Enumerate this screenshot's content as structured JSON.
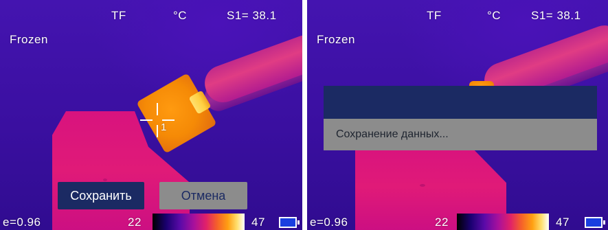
{
  "left_screen": {
    "storage": "TF",
    "unit": "°C",
    "spot_reading": "S1= 38.1",
    "mode": "Frozen",
    "spot_marker": "1",
    "emissivity": "e=0.96",
    "scale_min": "22",
    "scale_max": "47",
    "buttons": {
      "save": "Сохранить",
      "cancel": "Отмена"
    }
  },
  "right_screen": {
    "storage": "TF",
    "unit": "°C",
    "spot_reading": "S1= 38.1",
    "mode": "Frozen",
    "emissivity": "e=0.96",
    "scale_min": "22",
    "scale_max": "47",
    "dialog_message": "Сохранение данных..."
  },
  "colors": {
    "button_dark": "#1b2a63",
    "button_gray": "#8c8c8c",
    "battery_fill": "#1a3fe0"
  },
  "icons": {
    "battery": "battery-icon",
    "crosshair": "crosshair-icon"
  }
}
